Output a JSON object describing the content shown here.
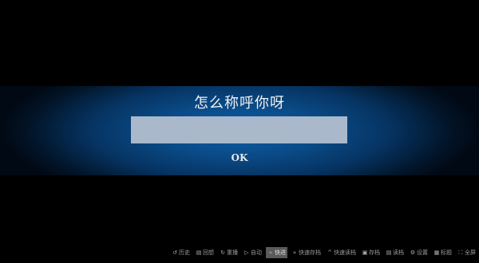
{
  "dialog": {
    "title": "怎么称呼你呀",
    "input_value": "",
    "input_placeholder": "",
    "ok_label": "OK"
  },
  "quick_menu": {
    "items": [
      {
        "label": "历史",
        "icon": "history-icon",
        "glyph": "↺",
        "active": false
      },
      {
        "label": "回想",
        "icon": "rollback-icon",
        "glyph": "▤",
        "active": false
      },
      {
        "label": "重播",
        "icon": "replay-icon",
        "glyph": "↻",
        "active": false
      },
      {
        "label": "自动",
        "icon": "auto-play-icon",
        "glyph": "▷",
        "active": false
      },
      {
        "label": "快进",
        "icon": "skip-icon",
        "glyph": "»",
        "active": true
      },
      {
        "label": "快速存档",
        "icon": "quick-save-icon",
        "glyph": "»",
        "active": false
      },
      {
        "label": "快速读档",
        "icon": "quick-load-icon",
        "glyph": "^",
        "active": false
      },
      {
        "label": "存档",
        "icon": "save-icon",
        "glyph": "▣",
        "active": false
      },
      {
        "label": "读档",
        "icon": "load-icon",
        "glyph": "▤",
        "active": false
      },
      {
        "label": "设置",
        "icon": "settings-icon",
        "glyph": "⚙",
        "active": false
      },
      {
        "label": "标题",
        "icon": "title-screen-icon",
        "glyph": "▦",
        "active": false
      },
      {
        "label": "全屏",
        "icon": "fullscreen-icon",
        "glyph": "⛶",
        "active": false
      }
    ]
  },
  "colors": {
    "background": "#000000",
    "band_center": "#0d5fa8",
    "band_edge": "#010914",
    "input_fill": "#a9b8cb",
    "text": "#f2f2f2",
    "menu_text": "#9a9a9a",
    "menu_active_bg": "#5a5a5a"
  }
}
